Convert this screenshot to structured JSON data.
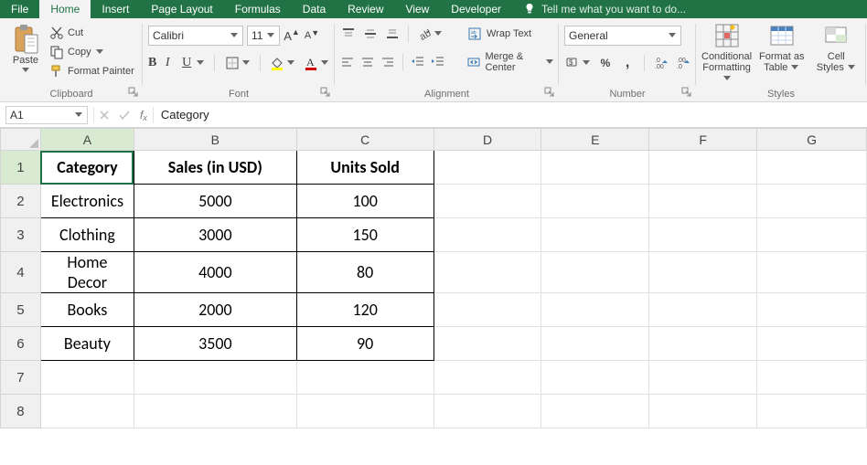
{
  "tabs": {
    "file": "File",
    "home": "Home",
    "insert": "Insert",
    "page_layout": "Page Layout",
    "formulas": "Formulas",
    "data": "Data",
    "review": "Review",
    "view": "View",
    "developer": "Developer",
    "tellme": "Tell me what you want to do..."
  },
  "ribbon": {
    "clipboard": {
      "paste": "Paste",
      "cut": "Cut",
      "copy": "Copy",
      "format_painter": "Format Painter",
      "group_label": "Clipboard"
    },
    "font": {
      "name": "Calibri",
      "size": "11",
      "group_label": "Font"
    },
    "alignment": {
      "wrap_text": "Wrap Text",
      "merge_center": "Merge & Center",
      "group_label": "Alignment"
    },
    "number": {
      "format": "General",
      "percent": "%",
      "comma": ",",
      "group_label": "Number"
    },
    "styles": {
      "conditional_formatting_l1": "Conditional",
      "conditional_formatting_l2": "Formatting",
      "format_table_l1": "Format as",
      "format_table_l2": "Table",
      "cell_styles_l1": "Cell",
      "cell_styles_l2": "Styles",
      "group_label": "Styles"
    }
  },
  "formula_bar": {
    "cell_ref": "A1",
    "formula": "Category"
  },
  "columns": [
    "A",
    "B",
    "C",
    "D",
    "E",
    "F",
    "G"
  ],
  "row_numbers": [
    "1",
    "2",
    "3",
    "4",
    "5",
    "6",
    "7",
    "8"
  ],
  "selected_cell": "A1",
  "chart_data": {
    "type": "table",
    "headers": [
      "Category",
      "Sales (in USD)",
      "Units Sold"
    ],
    "rows": [
      [
        "Electronics",
        "5000",
        "100"
      ],
      [
        "Clothing",
        "3000",
        "150"
      ],
      [
        "Home Decor",
        "4000",
        "80"
      ],
      [
        "Books",
        "2000",
        "120"
      ],
      [
        "Beauty",
        "3500",
        "90"
      ]
    ]
  }
}
